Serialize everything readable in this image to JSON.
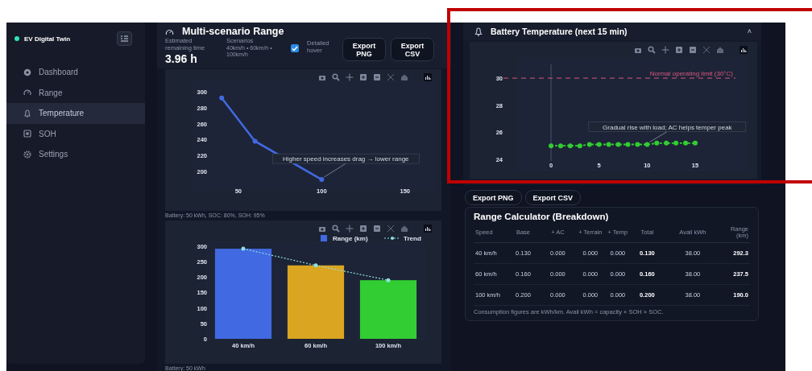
{
  "sidebar": {
    "brand": "EV Digital Twin",
    "items": [
      {
        "label": "Dashboard",
        "kind": "dashboard",
        "selected": false
      },
      {
        "label": "Range",
        "kind": "gauge",
        "selected": false
      },
      {
        "label": "Temperature",
        "kind": "thermometer",
        "selected": true
      },
      {
        "label": "SOH",
        "kind": "chip",
        "selected": false
      },
      {
        "label": "Settings",
        "kind": "gear",
        "selected": false
      }
    ]
  },
  "range_panel": {
    "title": "Multi-scenario Range",
    "estimate": {
      "label": "Estimated remaining time",
      "value": "3.96 h"
    },
    "scenarios": {
      "label": "Scenarios",
      "value": "40km/h • 60km/h • 100km/h"
    },
    "detailed_hover": {
      "label": "Detailed hover",
      "checked": true
    },
    "buttons": [
      "Export PNG",
      "Export CSV"
    ],
    "line_chart": {
      "chart_data": {
        "type": "line",
        "x": [
          40,
          60,
          100
        ],
        "series": [
          {
            "color": "#4169e1",
            "marker": "circle",
            "values": [
              292,
              238,
              190
            ]
          }
        ],
        "xlim": [
          23,
          168
        ],
        "ylim": [
          177,
          313
        ],
        "xticks": [
          50,
          100,
          150
        ],
        "yticks": [
          200,
          220,
          240,
          260,
          280,
          300
        ],
        "annotations": [
          {
            "text": "Higher speed increases drag → lower range",
            "x": 100,
            "y": 190
          }
        ]
      }
    },
    "caption": "Battery: 50 kWh, SOC: 80%, SOH: 95%",
    "bar_chart": {
      "chart_data": {
        "type": "bar",
        "categories": [
          "40 km/h",
          "60 km/h",
          "100 km/h"
        ],
        "series": [
          {
            "name": "Range (km)",
            "type": "bar",
            "color": "#4169e1",
            "colors": [
              "#4169e1",
              "#daa520",
              "#32cd32"
            ],
            "values": [
              292,
              238,
              190
            ]
          },
          {
            "name": "Trend",
            "type": "line",
            "color": "#8fe0e0",
            "line_style": "dotted",
            "values": [
              292,
              238,
              190
            ]
          }
        ],
        "ylim": [
          0,
          313
        ],
        "yticks": [
          0,
          50,
          100,
          150,
          200,
          250,
          300
        ],
        "legend": "top-right"
      }
    },
    "caption_2": "Battery: 50 kWh"
  },
  "temperature_panel": {
    "title": "Battery Temperature (next 15 min)",
    "collapse": "˄",
    "chart_data": {
      "type": "line",
      "x": [
        0,
        1,
        2,
        3,
        4,
        5,
        6,
        7,
        8,
        9,
        10,
        11,
        12,
        13,
        14,
        15
      ],
      "series": [
        {
          "color": "#32cd32",
          "line_style": "dashed",
          "marker": "circle",
          "values": [
            25.0,
            25.0,
            25.0,
            25.0,
            25.1,
            25.1,
            25.1,
            25.1,
            25.1,
            25.1,
            25.1,
            25.2,
            25.2,
            25.2,
            25.2,
            25.2
          ]
        }
      ],
      "xlim": [
        -3.44,
        20.45
      ],
      "ylim": [
        23.17,
        31.49
      ],
      "xticks": [
        0,
        5,
        10,
        15
      ],
      "yticks": [
        24,
        26,
        28,
        30
      ],
      "ref_lines": [
        {
          "axis": "y",
          "value": 30,
          "label": "Normal operating limit (30°C)",
          "color": "#d9577f"
        }
      ],
      "annotations": [
        {
          "text": "Gradual rise with load; AC helps temper peak",
          "x": 10,
          "y": 25.1
        }
      ]
    }
  },
  "export_buttons": [
    "Export PNG",
    "Export CSV"
  ],
  "calculator": {
    "title": "Range Calculator (Breakdown)",
    "columns": [
      {
        "label": "Speed",
        "emphasis": false
      },
      {
        "label": "Base",
        "emphasis": false
      },
      {
        "label": "+ AC",
        "emphasis": false
      },
      {
        "label": "+ Terrain",
        "emphasis": false
      },
      {
        "label": "+ Temp",
        "emphasis": false
      },
      {
        "label": "Total",
        "emphasis": true
      },
      {
        "label": "Avail kWh",
        "emphasis": false
      },
      {
        "label": "Range (km)",
        "emphasis": true
      }
    ],
    "rows": [
      [
        "40 km/h",
        "0.130",
        "0.000",
        "0.000",
        "0.000",
        "0.130",
        "38.00",
        "292.3"
      ],
      [
        "60 km/h",
        "0.160",
        "0.000",
        "0.000",
        "0.000",
        "0.160",
        "38.00",
        "237.5"
      ],
      [
        "100 km/h",
        "0.200",
        "0.000",
        "0.000",
        "0.000",
        "0.200",
        "38.00",
        "190.0"
      ]
    ],
    "note": "Consumption figures are kWh/km. Avail kWh = capacity × SOH × SOC."
  }
}
